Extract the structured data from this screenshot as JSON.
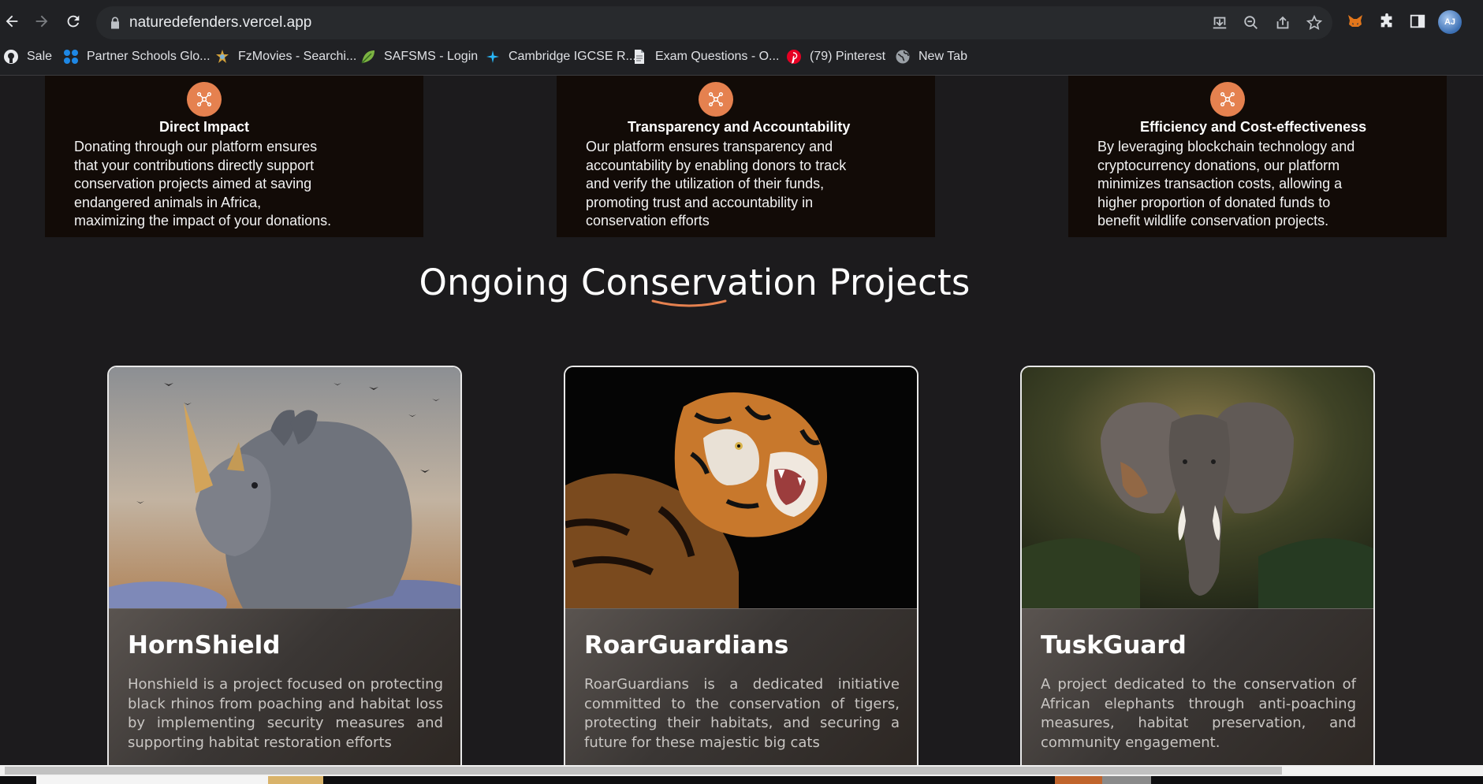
{
  "browser": {
    "url": "naturedefenders.vercel.app",
    "profile_initials": "AJ",
    "bookmarks": [
      {
        "label": "Sale",
        "icon": "github-icon"
      },
      {
        "label": "Partner Schools Glo...",
        "icon": "dots-icon"
      },
      {
        "label": "FzMovies - Searchi...",
        "icon": "fzmovies-icon"
      },
      {
        "label": "SAFSMS - Login",
        "icon": "leaf-icon"
      },
      {
        "label": "Cambridge IGCSE R...",
        "icon": "spark-icon"
      },
      {
        "label": "Exam Questions - O...",
        "icon": "document-icon"
      },
      {
        "label": "(79) Pinterest",
        "icon": "pinterest-icon"
      },
      {
        "label": "New Tab",
        "icon": "globe-icon"
      }
    ]
  },
  "features": [
    {
      "title": "Direct Impact",
      "desc_lines": [
        "Donating through our platform ensures",
        "that your contributions directly support",
        "conservation projects aimed at saving",
        "endangered animals in Africa,",
        "maximizing the impact of your donations."
      ]
    },
    {
      "title": "Transparency and Accountability",
      "desc_lines": [
        "Our platform ensures transparency and",
        "accountability by enabling donors to track",
        "and verify the utilization of their funds,",
        "promoting trust and accountability in",
        "conservation efforts"
      ]
    },
    {
      "title": "Efficiency and Cost-effectiveness",
      "desc_lines": [
        "By leveraging blockchain technology and",
        "cryptocurrency donations, our platform",
        "minimizes transaction costs, allowing a",
        "higher proportion of donated funds to",
        "benefit wildlife conservation projects."
      ]
    }
  ],
  "projects_section": {
    "title": "Ongoing Conservation Projects",
    "accent_color": "#e5814f"
  },
  "projects": [
    {
      "name": "HornShield",
      "description": "Honshield is a project focused on protecting black rhinos from poaching and habitat loss by implementing security measures and supporting habitat restoration efforts"
    },
    {
      "name": "RoarGuardians",
      "description": "RoarGuardians is a dedicated initiative committed to the conservation of tigers, protecting their habitats, and securing a future for these majestic big cats"
    },
    {
      "name": "TuskGuard",
      "description": "A project dedicated to the conservation of African elephants through anti-poaching measures, habitat preservation, and community engagement."
    }
  ]
}
